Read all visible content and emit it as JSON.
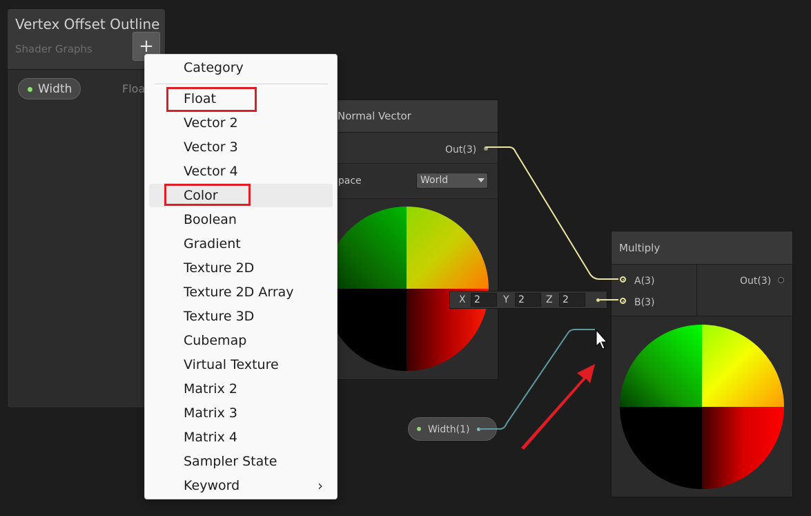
{
  "blackboard": {
    "title": "Vertex Offset Outline",
    "subtitle": "Shader Graphs",
    "add_label": "+",
    "property": {
      "name": "Width",
      "type": "Float"
    }
  },
  "normal_vector_node": {
    "title": "Normal Vector",
    "output_label": "Out(3)",
    "space_label": "Space",
    "space_value": "World"
  },
  "multiply_node": {
    "title": "Multiply",
    "input_a_label": "A(3)",
    "input_b_label": "B(3)",
    "output_label": "Out(3)"
  },
  "vector_input": {
    "x_label": "X",
    "x_value": "2",
    "y_label": "Y",
    "y_value": "2",
    "z_label": "Z",
    "z_value": "2"
  },
  "width_node": {
    "label": "Width(1)"
  },
  "menu": {
    "header": "Category",
    "items": [
      {
        "label": "Float",
        "highlighted": false,
        "boxed": true
      },
      {
        "label": "Vector 2"
      },
      {
        "label": "Vector 3"
      },
      {
        "label": "Vector 4"
      },
      {
        "label": "Color",
        "highlighted": true,
        "boxed": true
      },
      {
        "label": "Boolean"
      },
      {
        "label": "Gradient"
      },
      {
        "label": "Texture 2D"
      },
      {
        "label": "Texture 2D Array"
      },
      {
        "label": "Texture 3D"
      },
      {
        "label": "Cubemap"
      },
      {
        "label": "Virtual Texture"
      },
      {
        "label": "Matrix 2"
      },
      {
        "label": "Matrix 3"
      },
      {
        "label": "Matrix 4"
      },
      {
        "label": "Sampler State"
      },
      {
        "label": "Keyword",
        "has_submenu": true,
        "submenu_glyph": "›"
      }
    ]
  },
  "colors": {
    "canvas_bg": "#1d1d1d",
    "edge_vector3": "#ece79d",
    "edge_float": "#5d9ba0",
    "annotation_red": "#e01d24"
  }
}
